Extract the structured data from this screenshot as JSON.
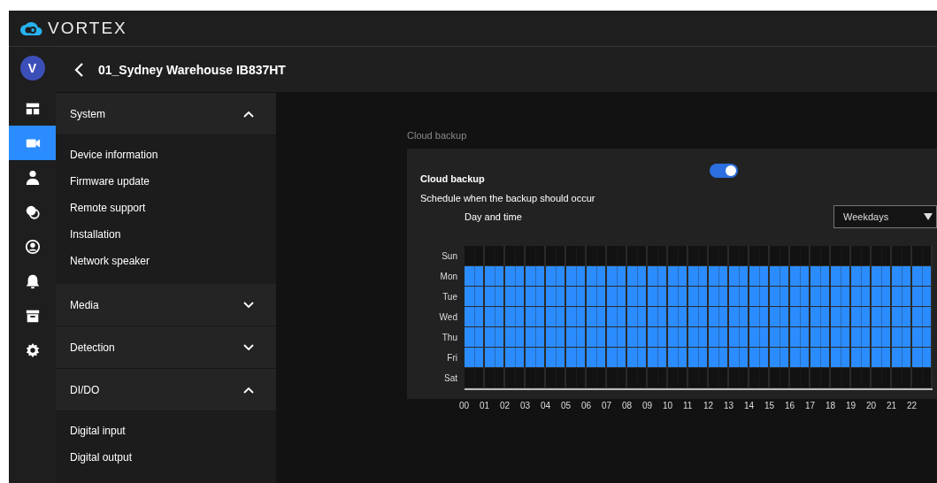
{
  "brand": {
    "name": "VORTEX"
  },
  "rail": {
    "avatar": "V",
    "items": [
      {
        "kind": "dashboard",
        "selected": false
      },
      {
        "kind": "camera",
        "selected": true
      },
      {
        "kind": "person",
        "selected": false
      },
      {
        "kind": "circles",
        "selected": false
      },
      {
        "kind": "user-circle",
        "selected": false
      },
      {
        "kind": "bell",
        "selected": false
      },
      {
        "kind": "archive",
        "selected": false
      },
      {
        "kind": "gear",
        "selected": false
      }
    ]
  },
  "device": {
    "title": "01_Sydney Warehouse IB837HT"
  },
  "sections": [
    {
      "label": "System",
      "expanded": true,
      "items": [
        "Device information",
        "Firmware update",
        "Remote support",
        "Installation",
        "Network speaker"
      ]
    },
    {
      "label": "Media",
      "expanded": false
    },
    {
      "label": "Detection",
      "expanded": false
    },
    {
      "label": "DI/DO",
      "expanded": true,
      "items": [
        "Digital input",
        "Digital output"
      ]
    }
  ],
  "panel": {
    "caption": "Cloud backup",
    "title": "Cloud backup",
    "on": true,
    "description": "Schedule when the backup should occur",
    "day_time_label": "Day and time",
    "dropdown": {
      "value": "Weekdays"
    },
    "hours": [
      "00",
      "01",
      "02",
      "03",
      "04",
      "05",
      "06",
      "07",
      "08",
      "09",
      "10",
      "11",
      "12",
      "13",
      "14",
      "15",
      "16",
      "17",
      "18",
      "19",
      "20",
      "21",
      "22"
    ],
    "days": [
      {
        "label": "Sun",
        "active": false
      },
      {
        "label": "Mon",
        "active": true
      },
      {
        "label": "Tue",
        "active": true
      },
      {
        "label": "Wed",
        "active": true
      },
      {
        "label": "Thu",
        "active": true
      },
      {
        "label": "Fri",
        "active": true
      },
      {
        "label": "Sat",
        "active": false
      }
    ]
  }
}
